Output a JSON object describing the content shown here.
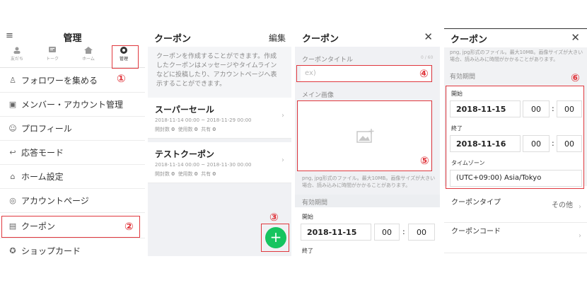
{
  "panel1": {
    "title": "管理",
    "tabs": [
      {
        "label": "友だち"
      },
      {
        "label": "トーク"
      },
      {
        "label": "ホーム"
      },
      {
        "label": "管理"
      }
    ],
    "items": [
      {
        "label": "フォロワーを集める",
        "icon": "person-plus-icon"
      },
      {
        "label": "メンバー・アカウント管理",
        "icon": "id-card-icon"
      },
      {
        "label": "プロフィール",
        "icon": "profile-icon"
      },
      {
        "label": "応答モード",
        "icon": "reply-mode-icon"
      },
      {
        "label": "ホーム設定",
        "icon": "home-settings-icon"
      },
      {
        "label": "アカウントページ",
        "icon": "account-page-icon"
      },
      {
        "label": "クーポン",
        "icon": "coupon-icon"
      },
      {
        "label": "ショップカード",
        "icon": "shop-card-icon"
      }
    ],
    "marker1": "①",
    "marker2": "②"
  },
  "panel2": {
    "title": "クーポン",
    "edit": "編集",
    "description": "クーポンを作成することができます。作成したクーポンはメッセージやタイムラインなどに投稿したり、アカウントページへ表示することができます。",
    "coupons": [
      {
        "name": "スーパーセール",
        "period": "2018-11-14 00:00 ~ 2018-11-29 00:00",
        "opened_label": "開封数",
        "opened": "0",
        "used_label": "使用数",
        "used": "0",
        "shared_label": "共有",
        "shared": "0"
      },
      {
        "name": "テストクーポン",
        "period": "2018-11-14 00:00 ~ 2018-11-30 00:00",
        "opened_label": "開封数",
        "opened": "0",
        "used_label": "使用数",
        "used": "0",
        "shared_label": "共有",
        "shared": "0"
      }
    ],
    "fab": "+",
    "marker3": "③"
  },
  "panel3": {
    "title": "クーポン",
    "close": "✕",
    "coupon_title_label": "クーポンタイトル",
    "coupon_title_count": "0 / 60",
    "coupon_title_placeholder": "ex)",
    "main_image_label": "メイン画像",
    "image_note": "png, jpg形式のファイル。最大10MB。画像サイズが大きい場合、読み込みに時間がかかることがあります。",
    "period_label": "有効期間",
    "start_label": "開始",
    "start_date": "2018-11-15",
    "start_hour": "00",
    "start_min": "00",
    "end_label": "終了",
    "colon": ":",
    "marker4": "④",
    "marker5": "⑤"
  },
  "panel4": {
    "title": "クーポン",
    "close": "✕",
    "image_note": "png, jpg形式のファイル。最大10MB。画像サイズが大きい場合、読み込みに時間がかかることがあります。",
    "period_label": "有効期間",
    "start_label": "開始",
    "start_date": "2018-11-15",
    "start_hour": "00",
    "start_min": "00",
    "end_label": "終了",
    "end_date": "2018-11-16",
    "end_hour": "00",
    "end_min": "00",
    "timezone_label": "タイムゾーン",
    "timezone": "(UTC+09:00) Asia/Tokyo",
    "colon": ":",
    "coupon_type_label": "クーポンタイプ",
    "coupon_type_value": "その他",
    "coupon_code_label": "クーポンコード",
    "marker6": "⑥"
  },
  "colors": {
    "accent_red": "#e0383e",
    "fab_green": "#16c45f"
  }
}
